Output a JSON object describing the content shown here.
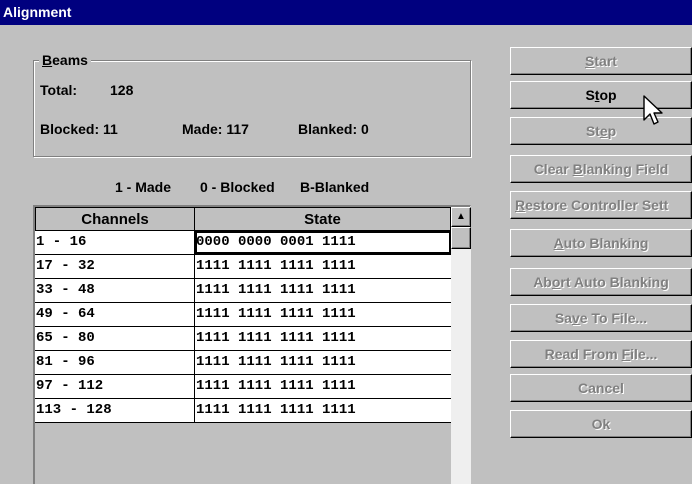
{
  "window": {
    "title": "Alignment"
  },
  "beams": {
    "legend_prefix": "B",
    "legend_rest": "eams",
    "total_label": "Total:",
    "total_value": "128",
    "blocked_text": "Blocked: 11",
    "made_text": "Made: 117",
    "blanked_text": "Blanked: 0"
  },
  "key": {
    "made": "1 - Made",
    "blocked": "0 - Blocked",
    "blanked": "B-Blanked"
  },
  "table": {
    "headers": [
      "Channels",
      "State"
    ],
    "rows": [
      {
        "channels": "1 - 16",
        "state": "0000 0000 0001 1111"
      },
      {
        "channels": "17 - 32",
        "state": "1111 1111 1111 1111"
      },
      {
        "channels": "33 - 48",
        "state": "1111 1111 1111 1111"
      },
      {
        "channels": "49 - 64",
        "state": "1111 1111 1111 1111"
      },
      {
        "channels": "65 - 80",
        "state": "1111 1111 1111 1111"
      },
      {
        "channels": "81 - 96",
        "state": "1111 1111 1111 1111"
      },
      {
        "channels": "97 - 112",
        "state": "1111 1111 1111 1111"
      },
      {
        "channels": "113 - 128",
        "state": "1111 1111 1111 1111"
      }
    ]
  },
  "buttons": {
    "start": {
      "pre": "",
      "u": "S",
      "post": "tart"
    },
    "stop": {
      "pre": "S",
      "u": "t",
      "post": "op"
    },
    "step": {
      "pre": "St",
      "u": "e",
      "post": "p"
    },
    "clear": {
      "pre": "Clear ",
      "u": "B",
      "post": "lanking Field"
    },
    "restore": {
      "pre": "",
      "u": "R",
      "post": "estore Controller Sett"
    },
    "auto": {
      "pre": "",
      "u": "A",
      "post": "uto Blanking"
    },
    "abort": {
      "pre": "Ab",
      "u": "o",
      "post": "rt Auto Blanking"
    },
    "save": {
      "pre": "Sa",
      "u": "v",
      "post": "e To File..."
    },
    "read": {
      "pre": "Read From ",
      "u": "F",
      "post": "ile..."
    },
    "cancel": {
      "pre": "Cancel",
      "u": "",
      "post": ""
    },
    "ok": {
      "pre": "Ok",
      "u": "",
      "post": ""
    }
  },
  "colors": {
    "face": "#c0c0c0",
    "title_bg": "#00007f",
    "disabled_text": "#808080"
  },
  "icons": {
    "cursor": "arrow-pointer-icon",
    "scroll_up": "triangle-up-icon"
  }
}
